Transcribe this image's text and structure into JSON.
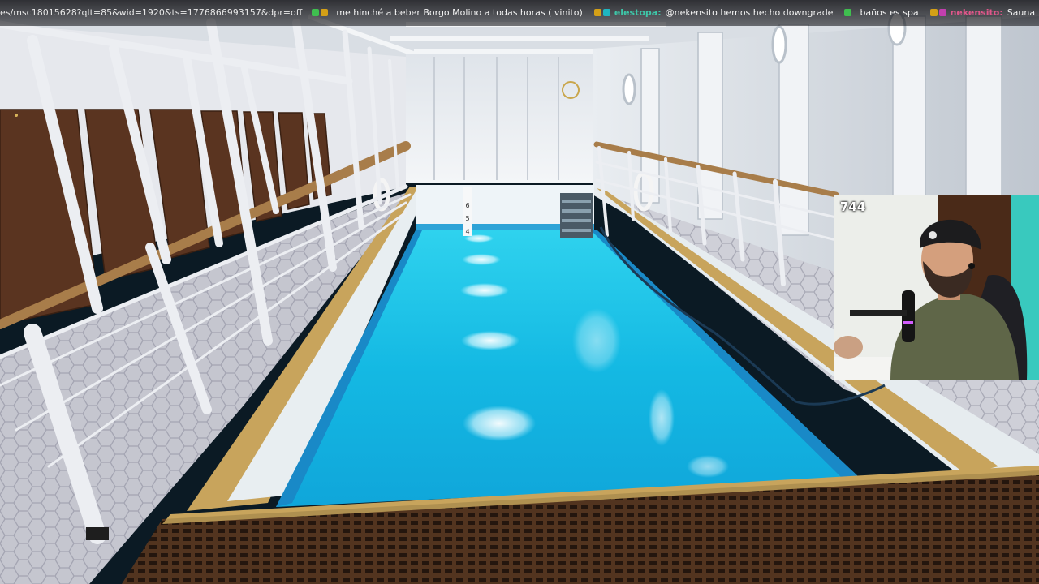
{
  "chat_ticker": {
    "url_fragment": "es/msc18015628?qlt=85&wid=1920&ts=1776866993157&dpr=off",
    "messages": [
      {
        "user": "",
        "user_color": "#8a5cf6",
        "badge_colors": [
          "#3fbf4f",
          "#d4a017"
        ],
        "text": "me hinché a beber Borgo Molino a todas horas ( vinito)"
      },
      {
        "user": "elestopa:",
        "user_color": "#3ec6a8",
        "badge_colors": [
          "#d4a017",
          "#1fb6c1"
        ],
        "text": "@nekensito hemos hecho downgrade"
      },
      {
        "user": "",
        "user_color": "#2e7d32",
        "badge_colors": [
          "#3fbf4f"
        ],
        "text": "baños es spa"
      },
      {
        "user": "nekensito:",
        "user_color": "#e0568a",
        "badge_colors": [
          "#d4a017",
          "#c23fae"
        ],
        "text": "Sauna"
      }
    ]
  },
  "webcam": {
    "viewer_count": "744"
  },
  "scene": {
    "pool_lane_markers": [
      "6",
      "5",
      "4"
    ]
  },
  "colors": {
    "pool_water": "#1ec8e8",
    "deck_tile": "#c9c9d2",
    "cabin_door": "#5a3420",
    "wood_grate": "#5b3b24",
    "railing": "#ecedf0"
  }
}
